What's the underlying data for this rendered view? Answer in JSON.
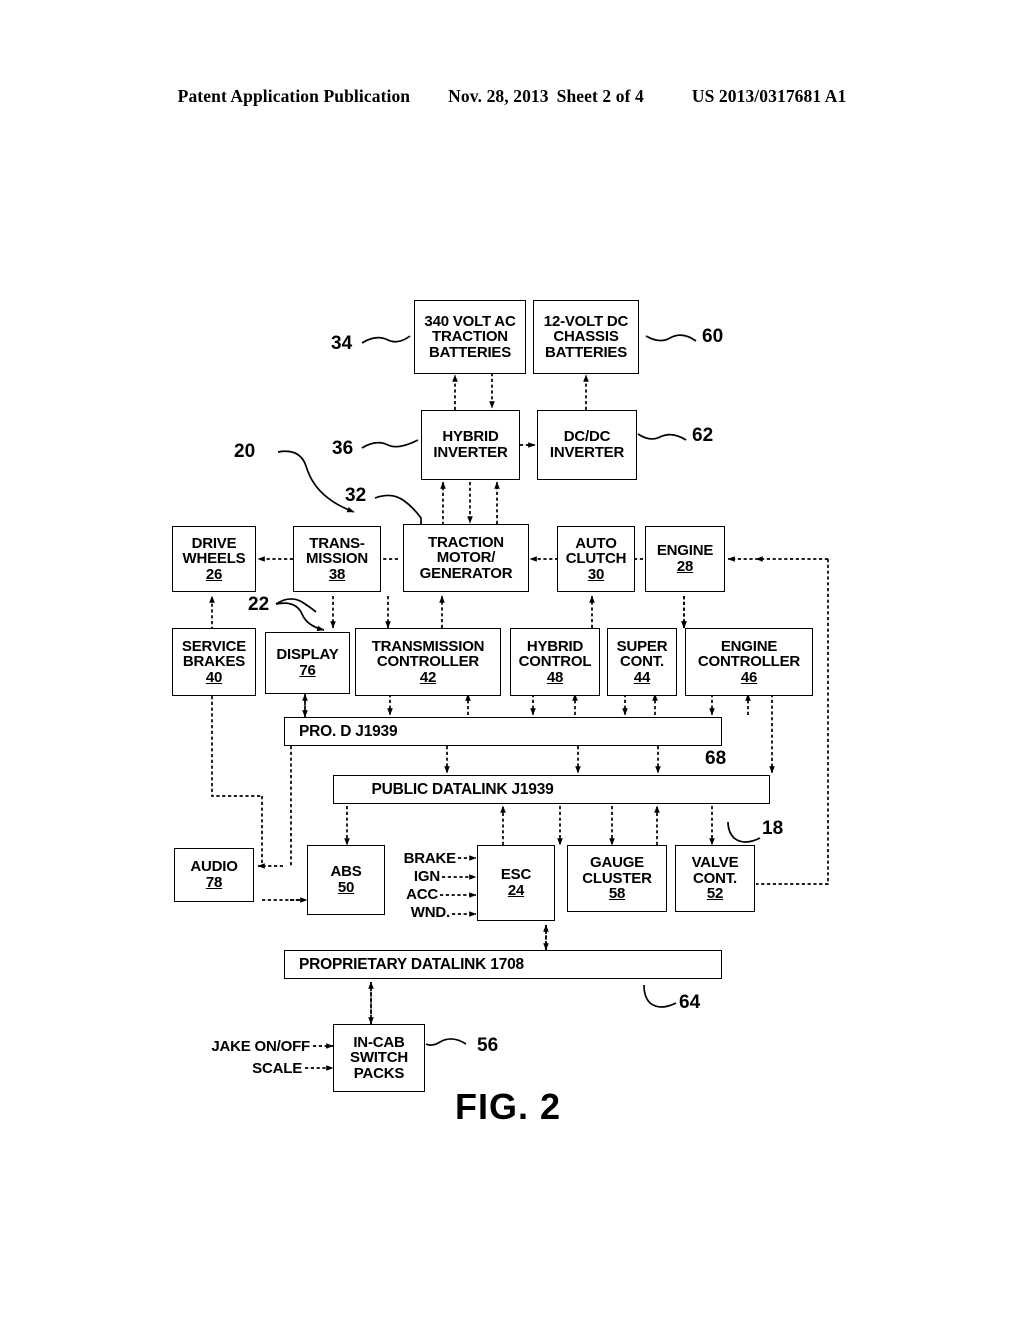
{
  "header": {
    "publication": "Patent Application Publication",
    "date": "Nov. 28, 2013",
    "sheet": "Sheet 2 of 4",
    "docnumber": "US 2013/0317681 A1"
  },
  "figure": {
    "caption": "FIG. 2",
    "line_color": "#000000",
    "background": "#ffffff"
  },
  "blocks": [
    {
      "id": "traction-batteries",
      "lines": [
        "340 VOLT AC",
        "TRACTION",
        "BATTERIES"
      ],
      "ref": "34"
    },
    {
      "id": "chassis-batteries",
      "lines": [
        "12-VOLT DC",
        "CHASSIS",
        "BATTERIES"
      ],
      "ref": "60"
    },
    {
      "id": "hybrid-inverter",
      "lines": [
        "HYBRID",
        "INVERTER"
      ],
      "ref": "36"
    },
    {
      "id": "dcdc-inverter",
      "lines": [
        "DC/DC",
        "INVERTER"
      ],
      "ref": "62"
    },
    {
      "id": "drive-wheels",
      "lines": [
        "DRIVE",
        "WHEELS"
      ],
      "num": "26"
    },
    {
      "id": "transmission",
      "lines": [
        "TRANS-",
        "MISSION"
      ],
      "num": "38"
    },
    {
      "id": "traction-motor",
      "lines": [
        "TRACTION",
        "MOTOR/",
        "GENERATOR"
      ],
      "ref": "32"
    },
    {
      "id": "auto-clutch",
      "lines": [
        "AUTO",
        "CLUTCH"
      ],
      "num": "30"
    },
    {
      "id": "engine",
      "lines": [
        "ENGINE"
      ],
      "num": "28"
    },
    {
      "id": "service-brakes",
      "lines": [
        "SERVICE",
        "BRAKES"
      ],
      "num": "40"
    },
    {
      "id": "display",
      "lines": [
        "DISPLAY"
      ],
      "num": "76"
    },
    {
      "id": "transmission-controller",
      "lines": [
        "TRANSMISSION",
        "CONTROLLER"
      ],
      "num": "42"
    },
    {
      "id": "hybrid-control",
      "lines": [
        "HYBRID",
        "CONTROL"
      ],
      "num": "48"
    },
    {
      "id": "super-cont",
      "lines": [
        "SUPER",
        "CONT."
      ],
      "num": "44"
    },
    {
      "id": "engine-controller",
      "lines": [
        "ENGINE",
        "CONTROLLER"
      ],
      "num": "46"
    },
    {
      "id": "audio",
      "lines": [
        "AUDIO"
      ],
      "num": "78"
    },
    {
      "id": "abs",
      "lines": [
        "ABS"
      ],
      "num": "50"
    },
    {
      "id": "esc",
      "lines": [
        "ESC"
      ],
      "num": "24"
    },
    {
      "id": "gauge-cluster",
      "lines": [
        "GAUGE",
        "CLUSTER"
      ],
      "num": "58"
    },
    {
      "id": "valve-cont",
      "lines": [
        "VALVE",
        "CONT."
      ],
      "num": "52"
    },
    {
      "id": "in-cab-switch-packs",
      "lines": [
        "IN-CAB",
        "SWITCH",
        "PACKS"
      ],
      "ref": "56"
    }
  ],
  "buses": [
    {
      "id": "pro-d-j1939",
      "label": "PRO. D J1939",
      "ref": "68"
    },
    {
      "id": "public-datalink-j1939",
      "label": "PUBLIC DATALINK J1939",
      "ref": "18"
    },
    {
      "id": "proprietary-datalink-1708",
      "label": "PROPRIETARY DATALINK 1708",
      "ref": "64"
    }
  ],
  "esc_inputs": [
    "BRAKE",
    "IGN",
    "ACC",
    "WND."
  ],
  "switch_inputs": [
    "JAKE ON/OFF",
    "SCALE"
  ],
  "reference_numerals": {
    "system": "20",
    "powertrain": "22",
    "traction_motor": "32",
    "traction_batteries": "34",
    "hybrid_inverter": "36",
    "chassis_batteries": "60",
    "dcdc_inverter": "62",
    "in_cab_switch_packs": "56",
    "pro_d": "68",
    "public_datalink": "18",
    "proprietary_datalink": "64"
  }
}
